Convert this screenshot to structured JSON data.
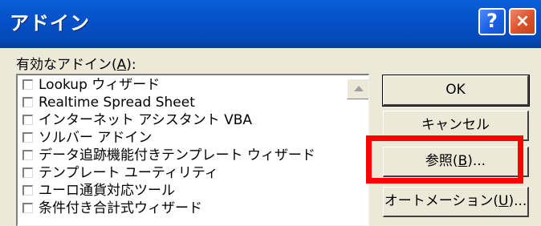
{
  "window": {
    "title": "アドイン",
    "help_label": "?",
    "close_label": "×"
  },
  "addins": {
    "label_prefix": "有効なアドイン(",
    "label_key": "A",
    "label_suffix": "):",
    "items": [
      {
        "label": "Lookup ウィザード",
        "checked": false
      },
      {
        "label": "Realtime Spread Sheet",
        "checked": false
      },
      {
        "label": "インターネット アシスタント VBA",
        "checked": false
      },
      {
        "label": "ソルバー アドイン",
        "checked": false
      },
      {
        "label": "データ追跡機能付きテンプレート ウィザード",
        "checked": false
      },
      {
        "label": "テンプレート ユーティリティ",
        "checked": false
      },
      {
        "label": "ユーロ通貨対応ツール",
        "checked": false
      },
      {
        "label": "条件付き合計式ウィザード",
        "checked": false
      }
    ]
  },
  "buttons": {
    "ok": "OK",
    "cancel": "キャンセル",
    "browse_prefix": "参照(",
    "browse_key": "B",
    "browse_suffix": ")...",
    "automation_prefix": "オートメーション(",
    "automation_key": "U",
    "automation_suffix": ")..."
  },
  "highlight_color": "#ff0000"
}
